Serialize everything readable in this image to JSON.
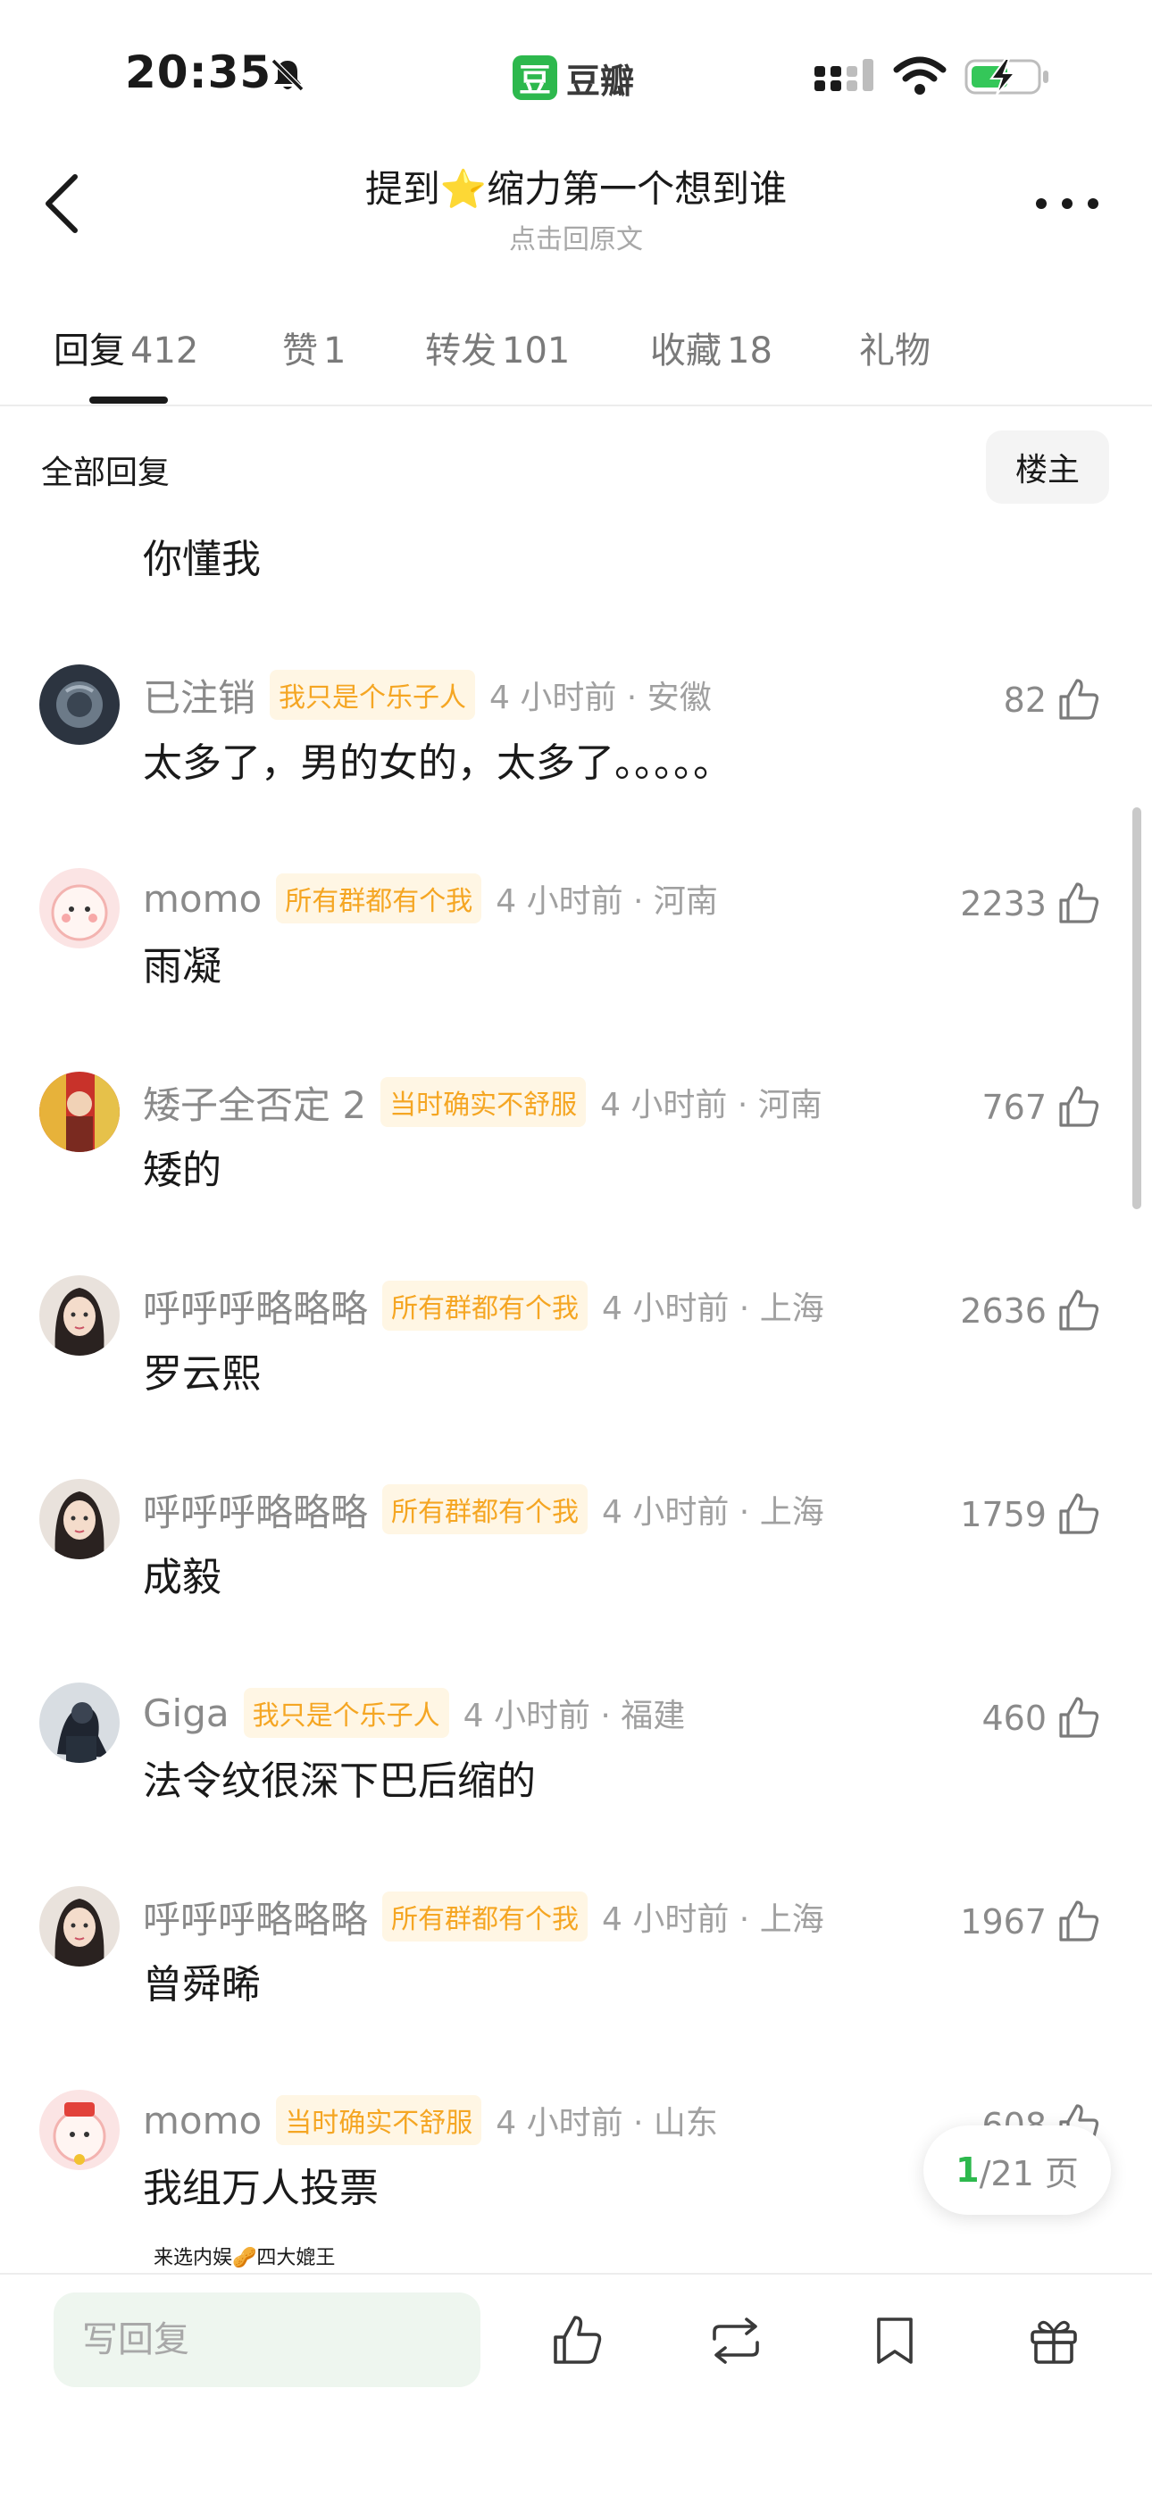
{
  "status": {
    "time": "20:35",
    "app_logo": "豆",
    "app_name": "豆瓣"
  },
  "header": {
    "title": "提到⭐缩力第一个想到谁",
    "subtitle": "点击回原文"
  },
  "tabs": [
    {
      "label": "回复",
      "count": "412"
    },
    {
      "label": "赞",
      "count": "1"
    },
    {
      "label": "转发",
      "count": "101"
    },
    {
      "label": "收藏",
      "count": "18"
    },
    {
      "label": "礼物",
      "count": ""
    }
  ],
  "filter": {
    "label": "全部回复",
    "toggle": "楼主"
  },
  "orphan_text": "你懂我",
  "comments": [
    {
      "user": "已注销",
      "tag": "我只是个乐子人",
      "time_loc": "4 小时前 · 安徽",
      "likes": "82",
      "text": "太多了，男的女的，太多了。。。。。"
    },
    {
      "user": "momo",
      "tag": "所有群都有个我",
      "time_loc": "4 小时前 · 河南",
      "likes": "2233",
      "text": "雨凝"
    },
    {
      "user": "矮子全否定 2",
      "tag": "当时确实不舒服",
      "time_loc": "4 小时前 · 河南",
      "likes": "767",
      "text": "矮的"
    },
    {
      "user": "呼呼呼略略略",
      "tag": "所有群都有个我",
      "time_loc": "4 小时前 · 上海",
      "likes": "2636",
      "text": "罗云熙"
    },
    {
      "user": "呼呼呼略略略",
      "tag": "所有群都有个我",
      "time_loc": "4 小时前 · 上海",
      "likes": "1759",
      "text": "成毅"
    },
    {
      "user": "Giga",
      "tag": "我只是个乐子人",
      "time_loc": "4 小时前 · 福建",
      "likes": "460",
      "text": "法令纹很深下巴后缩的"
    },
    {
      "user": "呼呼呼略略略",
      "tag": "所有群都有个我",
      "time_loc": "4 小时前 · 上海",
      "likes": "1967",
      "text": "曾舜晞"
    },
    {
      "user": "momo",
      "tag": "当时确实不舒服",
      "time_loc": "4 小时前 · 山东",
      "likes": "608",
      "text": "我组万人投票"
    }
  ],
  "pagination": {
    "current": "1",
    "total": "/21 页"
  },
  "promo": "来选内娱🥜四大媲王",
  "bottom": {
    "reply_placeholder": "写回复"
  },
  "colors": {
    "accent": "#2db84d",
    "tag_text": "#f5a623",
    "tag_bg": "#fff6e4"
  }
}
